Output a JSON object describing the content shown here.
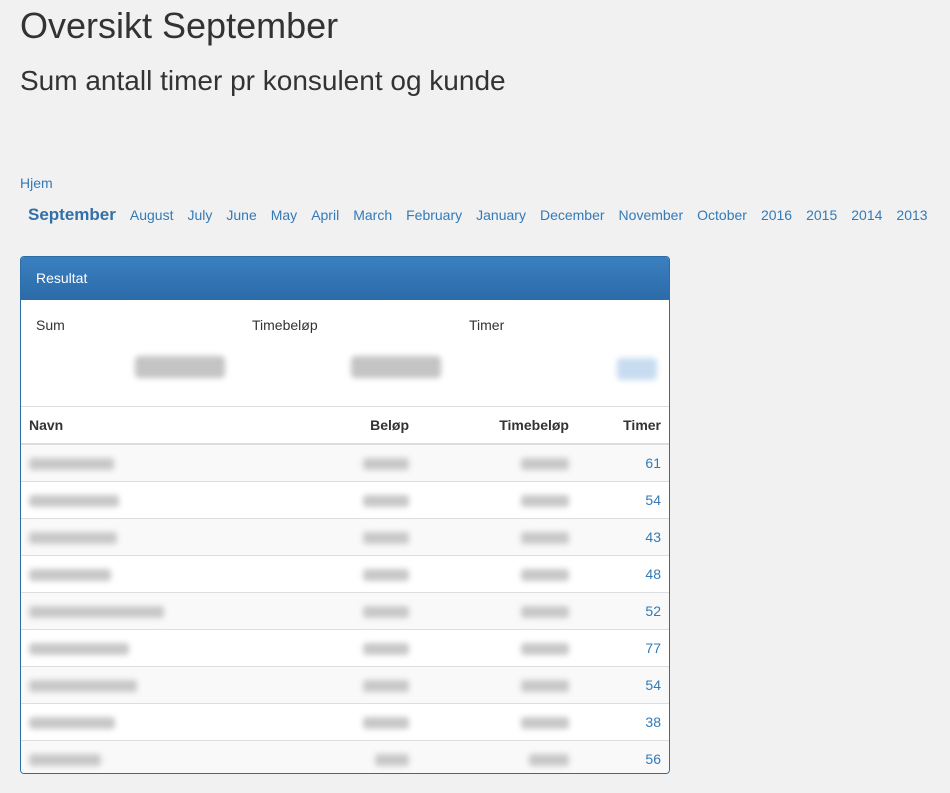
{
  "header": {
    "title": "Oversikt September",
    "subtitle": "Sum antall timer pr konsulent og kunde"
  },
  "nav": {
    "home": "Hjem",
    "months": [
      {
        "label": "September",
        "active": true
      },
      {
        "label": "August"
      },
      {
        "label": "July"
      },
      {
        "label": "June"
      },
      {
        "label": "May"
      },
      {
        "label": "April"
      },
      {
        "label": "March"
      },
      {
        "label": "February"
      },
      {
        "label": "January"
      },
      {
        "label": "December"
      },
      {
        "label": "November"
      },
      {
        "label": "October"
      },
      {
        "label": "2016"
      },
      {
        "label": "2015"
      },
      {
        "label": "2014"
      },
      {
        "label": "2013"
      }
    ]
  },
  "panel": {
    "heading": "Resultat",
    "summary_labels": {
      "sum": "Sum",
      "timebelop": "Timebeløp",
      "timer": "Timer"
    },
    "table": {
      "columns": {
        "navn": "Navn",
        "belop": "Beløp",
        "timebelop": "Timebeløp",
        "timer": "Timer"
      },
      "rows": [
        {
          "timer": "61"
        },
        {
          "timer": "54"
        },
        {
          "timer": "43"
        },
        {
          "timer": "48"
        },
        {
          "timer": "52"
        },
        {
          "timer": "77"
        },
        {
          "timer": "54"
        },
        {
          "timer": "38"
        },
        {
          "timer": "56"
        }
      ]
    }
  },
  "colors": {
    "accent": "#337ab7",
    "panel_heading": "#2c6ba8",
    "background": "#f1f1f1"
  }
}
